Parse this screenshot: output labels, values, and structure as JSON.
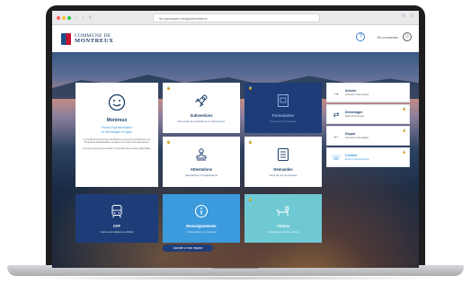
{
  "browser": {
    "url": "id.mycompte.ch/app/montreux",
    "nav": [
      "‹",
      "›",
      "↻"
    ],
    "right_icons": [
      "⟳",
      "≡"
    ]
  },
  "header": {
    "logo_line1": "COMMUNE DE",
    "logo_line2": "MONTREUX",
    "help_glyph": "?",
    "connection_label": "Se connecter",
    "avatar_glyph": "☺"
  },
  "hero": {
    "title": "Montreux",
    "subtitle_line1": "Portail d'administration",
    "subtitle_line2": "et d'échanges en ligne",
    "paragraph1": "Le Portail de la Commune de Montreux vous permet d'effectuer vos démarches administratives en ligne et de suivre leur avancement.",
    "paragraph2": "Connectez-vous pour accéder à l'ensemble des services disponibles."
  },
  "tiles": [
    {
      "title": "Subventions",
      "subtitle": "Demande de prestations et subventions",
      "icon": "rocket-icon",
      "locked": true
    },
    {
      "title": "Formulaires",
      "subtitle": "Accès aux formulaires",
      "icon": "form-icon",
      "locked": true
    },
    {
      "title": "Attestations",
      "subtitle": "Attestations et légalisations",
      "icon": "stamp-icon",
      "locked": true
    },
    {
      "title": "Demandes",
      "subtitle": "Suivi de vos demandes",
      "icon": "list-icon",
      "locked": true
    },
    {
      "title": "CFF",
      "subtitle": "Cartes journalières et billets",
      "icon": "train-icon",
      "locked": false
    },
    {
      "title": "Renseignements",
      "subtitle": "Informations et contacts",
      "icon": "info-icon",
      "locked": false
    },
    {
      "title": "Chiens",
      "subtitle": "Enregistrement des chiens",
      "icon": "dog-icon",
      "locked": true
    }
  ],
  "feed": [
    {
      "arrow": "→",
      "title": "Arrivée",
      "sub": "Annoncer votre arrivée",
      "locked": false,
      "highlight": false
    },
    {
      "arrow": "⇄",
      "title": "Déménager",
      "sub": "Dans la commune",
      "locked": true,
      "highlight": false
    },
    {
      "arrow": "←",
      "title": "Départ",
      "sub": "Annoncer votre départ",
      "locked": true,
      "highlight": false
    },
    {
      "arrow": "☏",
      "title": "Contact",
      "sub": "Écrire à l'administration",
      "locked": true,
      "highlight": true
    }
  ],
  "bottom_button": "Accéder à mon espace",
  "colors": {
    "navy": "#1e3d78",
    "blue": "#3b9bdc",
    "teal": "#6fc9d4",
    "logo": "#1d3f6a"
  }
}
